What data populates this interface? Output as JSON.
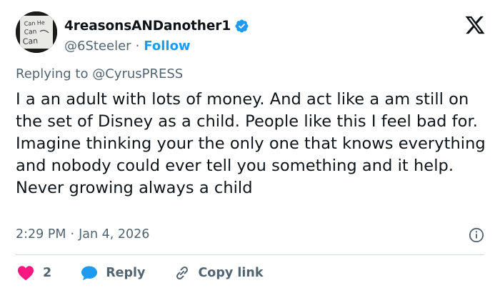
{
  "author": {
    "display_name": "4reasonsANDanother1",
    "handle": "@6Steeler",
    "separator": "·",
    "follow_label": "Follow",
    "verified": true,
    "avatar_text": [
      "Can He",
      "Can",
      "Can"
    ]
  },
  "reply_context": {
    "prefix": "Replying to",
    "mention": "@CyrusPRESS"
  },
  "tweet": {
    "text": "I a an adult with lots of money. And act like a am still on the set of Disney as a child. People like this I feel bad for. Imagine thinking your the only one that knows everything and nobody could ever tell you something and it help. Never growing always a child",
    "time": "2:29 PM",
    "separator": "·",
    "date": "Jan 4, 2026"
  },
  "actions": {
    "like_count": "2",
    "reply_label": "Reply",
    "copy_link_label": "Copy link"
  },
  "colors": {
    "accent": "#1d9bf0",
    "like": "#f91880",
    "muted": "#536471",
    "text": "#0f1419",
    "divider": "#cfd9de"
  },
  "icons": [
    "verified-badge-icon",
    "x-logo-icon",
    "info-icon",
    "heart-icon",
    "reply-bubble-icon",
    "link-icon"
  ]
}
